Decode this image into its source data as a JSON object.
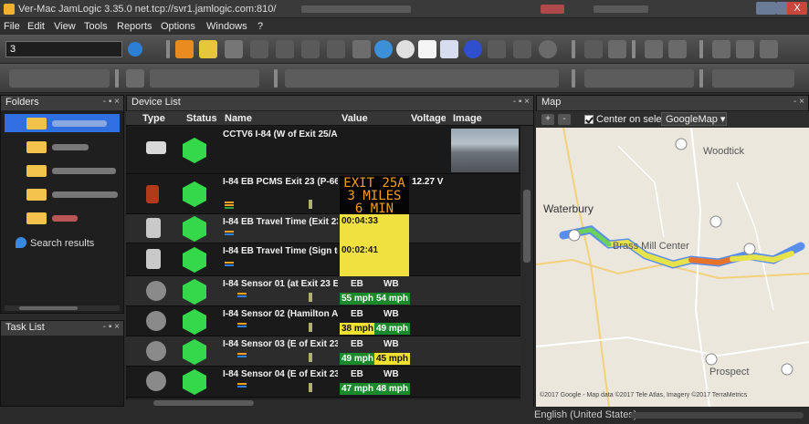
{
  "window": {
    "title": "Ver-Mac JamLogic 3.35.0 net.tcp://svr1.jamlogic.com:810/",
    "close_glyph": "X"
  },
  "menu": [
    "File",
    "Edit",
    "View",
    "Tools",
    "Reports",
    "Options",
    "Windows",
    "?"
  ],
  "toolbar": {
    "search_value": "3"
  },
  "folders": {
    "title": "Folders",
    "controls": "- ▪ ×",
    "search_results": "Search results"
  },
  "task_list": {
    "title": "Task List",
    "controls": "- ▪ ×"
  },
  "device_list": {
    "title": "Device List",
    "controls": "- ▪ ×",
    "columns": [
      "Type",
      "Status",
      "Name",
      "Value",
      "Voltage",
      "Image"
    ],
    "rows": [
      {
        "name": "CCTV6 I-84 (W of Exit 25/A"
      },
      {
        "name": "I-84 EB PCMS Exit 23 (P-66)",
        "message": [
          "EXIT 25A",
          "3 MILES",
          "6 MIN"
        ],
        "voltage": "12.27 V"
      },
      {
        "name": "I-84 EB Travel Time (Exit 23",
        "value": "00:04:33"
      },
      {
        "name": "I-84 EB Travel Time (Sign to",
        "value": "00:02:41"
      },
      {
        "name": "I-84 Sensor 01 (at Exit 23 E",
        "eb": "EB",
        "wb": "WB",
        "eb_speed": "55 mph",
        "wb_speed": "54 mph"
      },
      {
        "name": "I-84 Sensor 02 (Hamilton A",
        "eb": "EB",
        "wb": "WB",
        "eb_speed": "38 mph",
        "wb_speed": "49 mph"
      },
      {
        "name": "I-84 Sensor 03 (E of Exit 23,",
        "eb": "EB",
        "wb": "WB",
        "eb_speed": "49 mph",
        "wb_speed": "45 mph"
      },
      {
        "name": "I-84 Sensor 04 (E of Exit 23,",
        "eb": "EB",
        "wb": "WB",
        "eb_speed": "47 mph",
        "wb_speed": "48 mph"
      }
    ]
  },
  "map": {
    "title": "Map",
    "controls": "- ×",
    "center_on_select": "Center on select",
    "provider": "GoogleMap",
    "towns": [
      "Woodtick",
      "Waterbury",
      "Brass Mill Center",
      "Prospect"
    ],
    "route_shields": [
      "63",
      "844",
      "801",
      "69",
      "68",
      "84"
    ],
    "credit": "©2017 Google - Map data ©2017 Tele Atlas, Imagery ©2017 TerraMetrics"
  },
  "status_bar": {
    "language": "English (United States)"
  }
}
